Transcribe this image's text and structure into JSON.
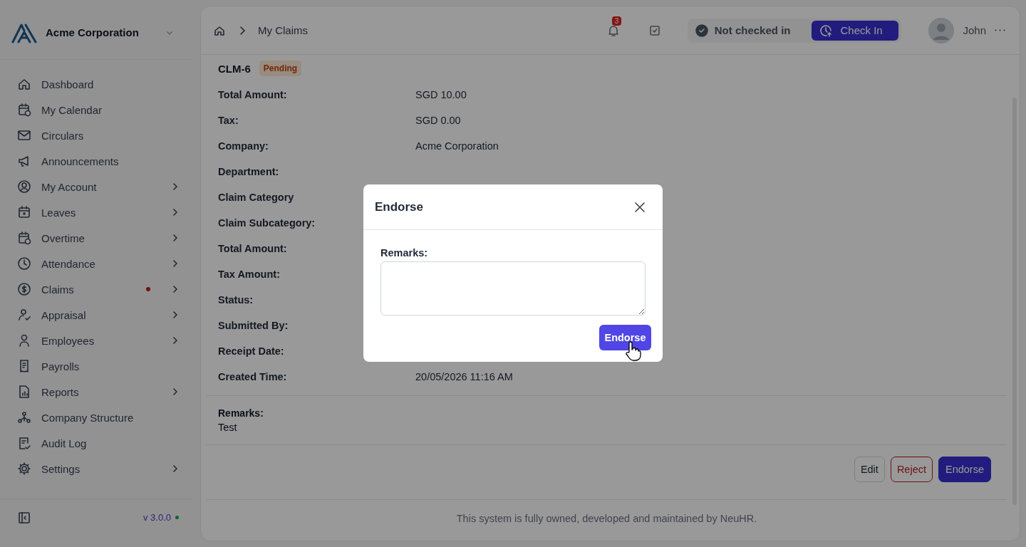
{
  "sidebar": {
    "company": "Acme Corporation",
    "items": [
      {
        "label": "Dashboard",
        "submenu": false,
        "dot": false
      },
      {
        "label": "My Calendar",
        "submenu": false,
        "dot": false
      },
      {
        "label": "Circulars",
        "submenu": false,
        "dot": false
      },
      {
        "label": "Announcements",
        "submenu": false,
        "dot": false
      },
      {
        "label": "My Account",
        "submenu": true,
        "dot": false
      },
      {
        "label": "Leaves",
        "submenu": true,
        "dot": false
      },
      {
        "label": "Overtime",
        "submenu": true,
        "dot": false
      },
      {
        "label": "Attendance",
        "submenu": true,
        "dot": false
      },
      {
        "label": "Claims",
        "submenu": true,
        "dot": true
      },
      {
        "label": "Appraisal",
        "submenu": true,
        "dot": false
      },
      {
        "label": "Employees",
        "submenu": true,
        "dot": false
      },
      {
        "label": "Payrolls",
        "submenu": false,
        "dot": false
      },
      {
        "label": "Reports",
        "submenu": true,
        "dot": false
      },
      {
        "label": "Company Structure",
        "submenu": false,
        "dot": false
      },
      {
        "label": "Audit Log",
        "submenu": false,
        "dot": false
      },
      {
        "label": "Settings",
        "submenu": true,
        "dot": false
      }
    ],
    "version": "v 3.0.0"
  },
  "header": {
    "breadcrumb": "My Claims",
    "notification_count": "3",
    "checkin_status": "Not checked in",
    "checkin_button": "Check In",
    "user": "John"
  },
  "claim": {
    "id": "CLM-6",
    "status": "Pending",
    "fields": [
      {
        "label": "Total Amount:",
        "value": "SGD 10.00"
      },
      {
        "label": "Tax:",
        "value": "SGD 0.00"
      },
      {
        "label": "Company:",
        "value": "Acme Corporation"
      },
      {
        "label": "Department:"
      },
      {
        "label": "Claim Category"
      },
      {
        "label": "Claim Subcategory:"
      },
      {
        "label": "Total Amount:"
      },
      {
        "label": "Tax Amount:"
      },
      {
        "label": "Status:"
      },
      {
        "label": "Submitted By:"
      },
      {
        "label": "Receipt Date:"
      },
      {
        "label": "Created Time:",
        "value": "20/05/2026 11:16 AM"
      }
    ],
    "remarks_label": "Remarks:",
    "remarks": "Test",
    "actions": [
      {
        "label": "Edit",
        "kind": "default"
      },
      {
        "label": "Reject",
        "kind": "danger"
      },
      {
        "label": "Endorse",
        "kind": "primary"
      }
    ]
  },
  "footer": "This system is fully owned, developed and maintained by NeuHR.",
  "modal": {
    "title": "Endorse",
    "field_label": "Remarks:",
    "button": "Endorse"
  }
}
